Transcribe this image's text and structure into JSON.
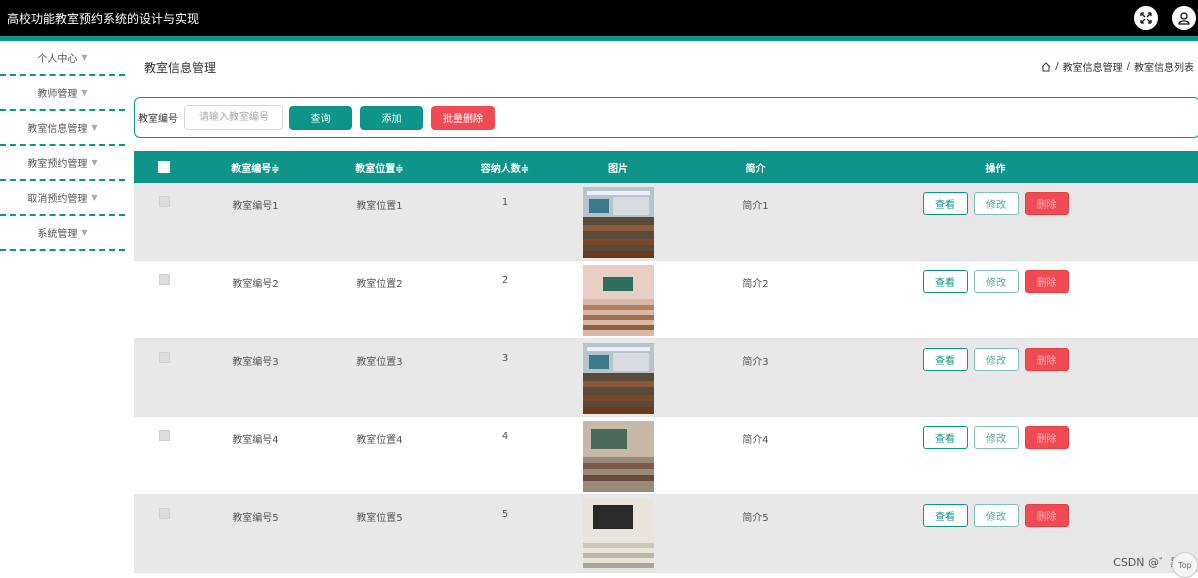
{
  "header": {
    "title": "高校功能教室预约系统的设计与实现",
    "fullscreen_icon": "expand-icon",
    "user_icon": "user-icon"
  },
  "sidebar": {
    "items": [
      {
        "label": "个人中心"
      },
      {
        "label": "教师管理"
      },
      {
        "label": "教室信息管理"
      },
      {
        "label": "教室预约管理"
      },
      {
        "label": "取消预约管理"
      },
      {
        "label": "系统管理"
      }
    ]
  },
  "page": {
    "title": "教室信息管理",
    "breadcrumb": [
      "教室信息管理",
      "教室信息列表"
    ],
    "breadcrumb_sep": "/"
  },
  "search": {
    "label": "教室编号",
    "placeholder": "请输入教室编号",
    "query_button": "查询",
    "add_button": "添加",
    "batch_delete_button": "批量删除"
  },
  "table": {
    "headers": [
      "教室编号≑",
      "教室位置≑",
      "容纳人数≑",
      "图片",
      "简介",
      "操作"
    ],
    "rows": [
      {
        "no": "教室编号1",
        "pos": "教室位置1",
        "cap": "1",
        "intro": "简介1"
      },
      {
        "no": "教室编号2",
        "pos": "教室位置2",
        "cap": "2",
        "intro": "简介2"
      },
      {
        "no": "教室编号3",
        "pos": "教室位置3",
        "cap": "3",
        "intro": "简介3"
      },
      {
        "no": "教室编号4",
        "pos": "教室位置4",
        "cap": "4",
        "intro": "简介4"
      },
      {
        "no": "教室编号5",
        "pos": "教室位置5",
        "cap": "5",
        "intro": "简介5"
      }
    ],
    "ops": {
      "view": "查看",
      "edit": "修改",
      "delete": "删除"
    }
  },
  "watermark": "CSDN @゛黑白",
  "back_to_top": "Top",
  "colors": {
    "accent": "#0e9488",
    "danger": "#f04b55",
    "header": "#000000"
  }
}
